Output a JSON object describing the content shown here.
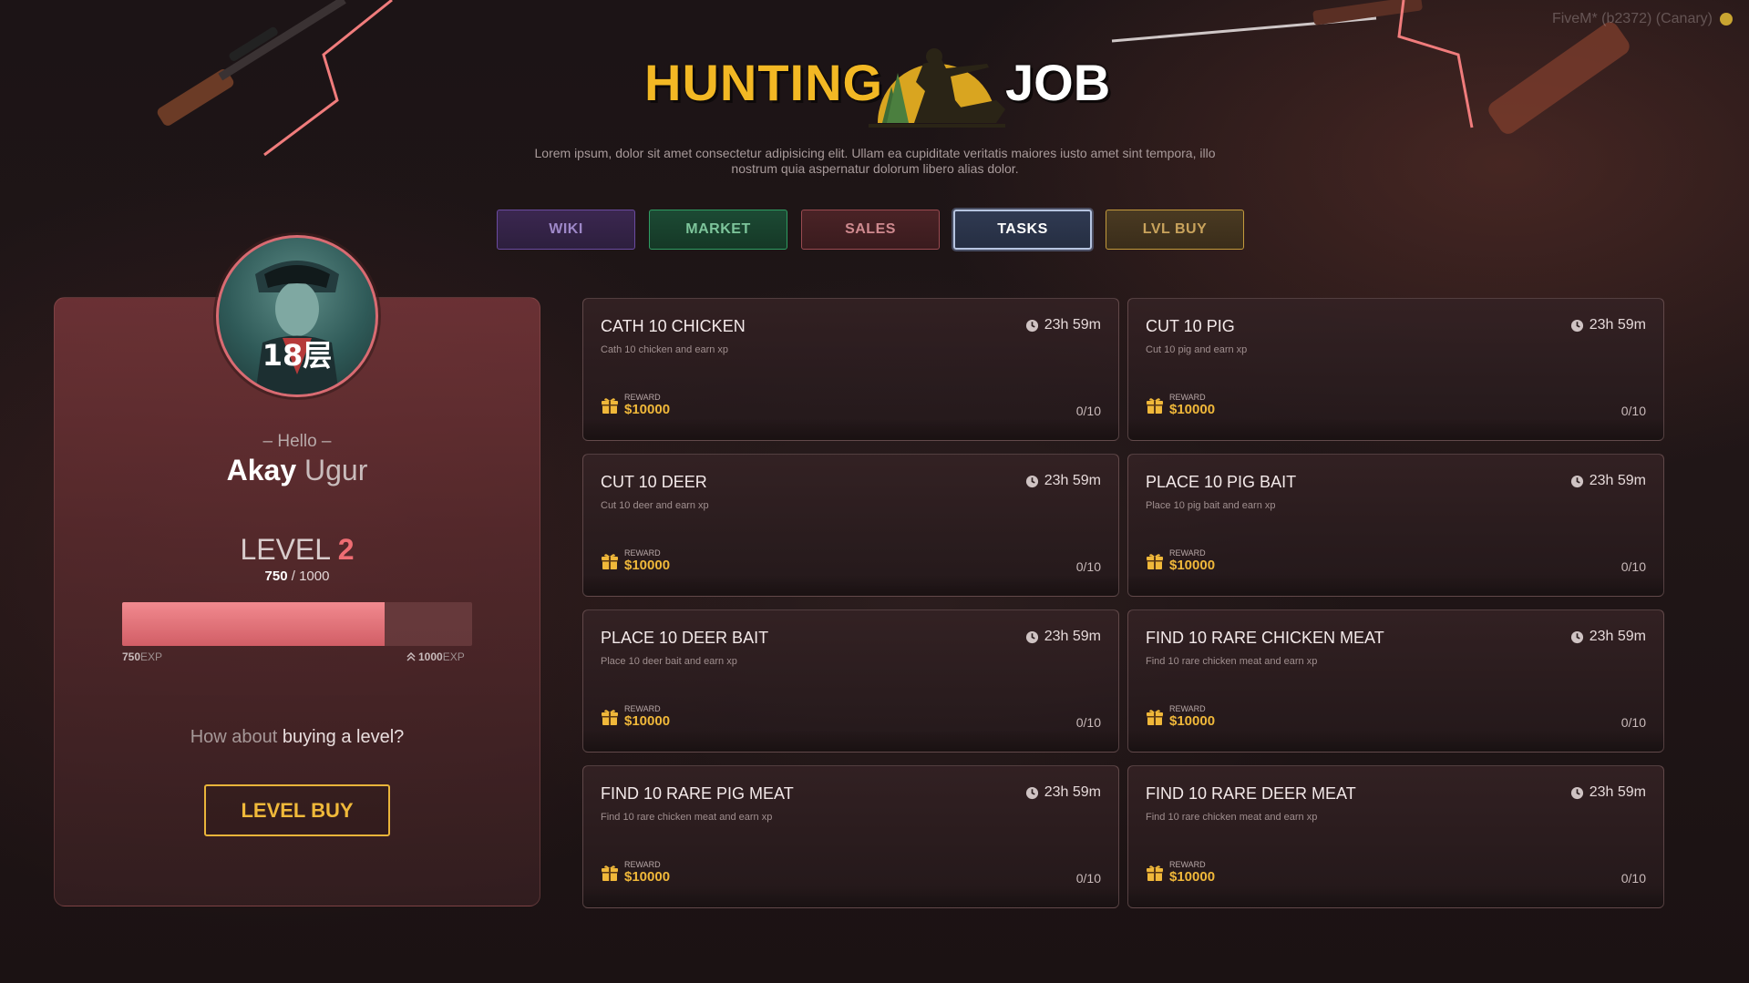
{
  "watermark": "FiveM* (b2372) (Canary)",
  "logo": {
    "word1": "HUNTING",
    "word2": "JOB"
  },
  "subtitle": "Lorem ipsum, dolor sit amet consectetur adipisicing elit. Ullam ea cupiditate veritatis maiores iusto amet sint tempora, illo nostrum quia aspernatur dolorum libero alias dolor.",
  "tabs": [
    {
      "label": "WIKI",
      "active": false
    },
    {
      "label": "MARKET",
      "active": false
    },
    {
      "label": "SALES",
      "active": false
    },
    {
      "label": "TASKS",
      "active": true
    },
    {
      "label": "LVL BUY",
      "active": false
    }
  ],
  "profile": {
    "avatar_text": "18层",
    "hello": "– Hello –",
    "first_name": "Akay",
    "last_name": "Ugur",
    "level_label": "LEVEL",
    "level_value": "2",
    "xp_current": "750",
    "xp_max": "/ 1000",
    "xp_fraction": 0.75,
    "bar_min_value": "750",
    "bar_min_unit": "EXP",
    "bar_max_value": "1000",
    "bar_max_unit": "EXP",
    "question_prefix": "How about ",
    "question_emphasis": "buying a level?",
    "buy_button": "LEVEL BUY"
  },
  "reward_label": "REWARD",
  "tasks": [
    {
      "title": "CATH 10 CHICKEN",
      "desc": "Cath 10 chicken and earn xp",
      "timer": "23h 59m",
      "reward": "$10000",
      "progress": "0/10"
    },
    {
      "title": "CUT 10 PIG",
      "desc": "Cut 10 pig and earn xp",
      "timer": "23h 59m",
      "reward": "$10000",
      "progress": "0/10"
    },
    {
      "title": "CUT 10 DEER",
      "desc": "Cut 10 deer and earn xp",
      "timer": "23h 59m",
      "reward": "$10000",
      "progress": "0/10"
    },
    {
      "title": "PLACE 10 PIG BAIT",
      "desc": "Place 10 pig bait and earn xp",
      "timer": "23h 59m",
      "reward": "$10000",
      "progress": "0/10"
    },
    {
      "title": "PLACE 10 DEER BAIT",
      "desc": "Place 10 deer bait and earn xp",
      "timer": "23h 59m",
      "reward": "$10000",
      "progress": "0/10"
    },
    {
      "title": "FIND 10 RARE CHICKEN MEAT",
      "desc": "Find 10 rare chicken meat and earn xp",
      "timer": "23h 59m",
      "reward": "$10000",
      "progress": "0/10"
    },
    {
      "title": "FIND 10 RARE PIG MEAT",
      "desc": "Find 10 rare chicken meat and earn xp",
      "timer": "23h 59m",
      "reward": "$10000",
      "progress": "0/10"
    },
    {
      "title": "FIND 10 RARE DEER MEAT",
      "desc": "Find 10 rare chicken meat and earn xp",
      "timer": "23h 59m",
      "reward": "$10000",
      "progress": "0/10"
    }
  ],
  "icons": {
    "timer": "clock-icon",
    "reward": "gift-icon",
    "level_max": "double-chevron-up-icon"
  },
  "colors": {
    "accent_gold": "#f0b83a",
    "level_red": "#ef6d73",
    "active_tab_border": "#b6c4e0"
  }
}
